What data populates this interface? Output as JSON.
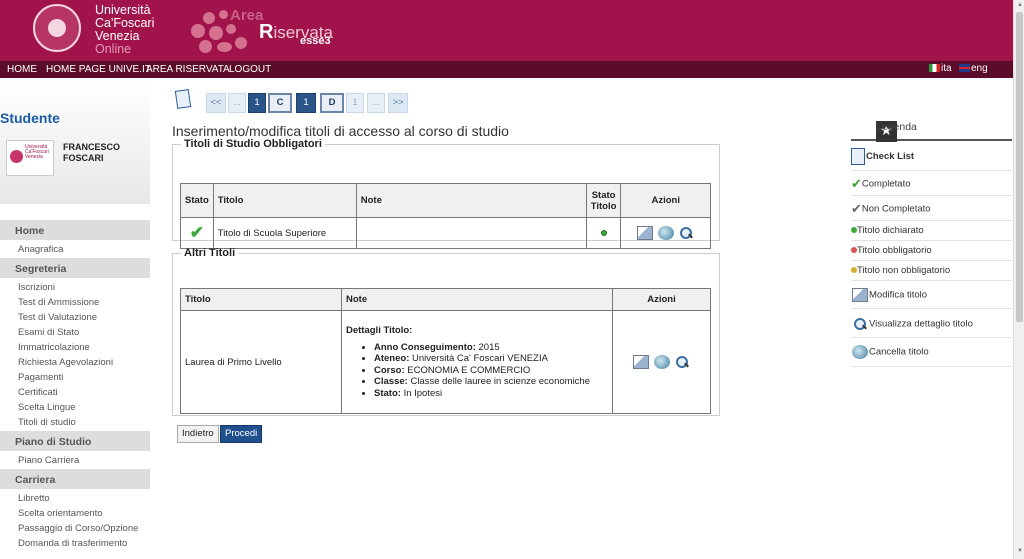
{
  "header": {
    "uni_line1": "Università",
    "uni_line2": "Ca'Foscari",
    "uni_line3": "Venezia",
    "uni_line4": "Online",
    "area_word": "Area",
    "riservata_word": "Riservata",
    "riservata_initial": "R",
    "riservata_rest": "iservata",
    "esse3": "esse3",
    "brand_color": "#a0144b"
  },
  "topnav": {
    "items": [
      "HOME",
      "HOME PAGE UNIVE.IT",
      "AREA RISERVATA",
      "LOGOUT"
    ],
    "lang_it": "ita",
    "lang_en": "eng"
  },
  "student": {
    "title": "Studente",
    "badge": "Università Ca'Foscari Venezia",
    "name_line1": "FRANCESCO",
    "name_line2": "FOSCARI"
  },
  "menu": {
    "home": "Home",
    "anagrafica": "Anagrafica",
    "segreteria": "Segreteria",
    "segreteria_items": [
      "Iscrizioni",
      "Test di Ammissione",
      "Test di Valutazione",
      "Esami di Stato",
      "Immatricolazione",
      "Richiesta Agevolazioni",
      "Pagamenti",
      "Certificati",
      "Scelta Lingue",
      "Titoli di studio"
    ],
    "piano": "Piano di Studio",
    "piano_items": [
      "Piano Carriera"
    ],
    "carriera": "Carriera",
    "carriera_items": [
      "Libretto",
      "Scelta orientamento",
      "Passaggio di Corso/Opzione",
      "Domanda di trasferimento"
    ]
  },
  "pager": {
    "first": "<<",
    "ellipsis": "...",
    "step1": "1",
    "labelC": "C",
    "step1b": "1",
    "labelD": "D",
    "next": "1",
    "ellipsis2": "...",
    "last": ">>"
  },
  "main": {
    "title": "Inserimento/modifica titoli di accesso al corso di studio",
    "obbligatori": {
      "legend": "Titoli di Studio Obbligatori",
      "headers": {
        "stato": "Stato",
        "titolo": "Titolo",
        "note": "Note",
        "stato_titolo_1": "Stato",
        "stato_titolo_2": "Titolo",
        "azioni": "Azioni"
      },
      "row": {
        "titolo": "Titolo di Scuola Superiore",
        "note": ""
      }
    },
    "altri": {
      "legend": "Altri Titoli",
      "headers": {
        "titolo": "Titolo",
        "note": "Note",
        "azioni": "Azioni"
      },
      "row": {
        "titolo": "Laurea di Primo Livello",
        "details_title": "Dettagli Titolo:",
        "details": [
          {
            "k": "Anno Conseguimento:",
            "v": "2015"
          },
          {
            "k": "Ateneo:",
            "v": "Università Ca' Foscari VENEZIA"
          },
          {
            "k": "Corso:",
            "v": "ECONOMIA E COMMERCIO"
          },
          {
            "k": "Classe:",
            "v": "Classe delle lauree in scienze economiche"
          },
          {
            "k": "Stato:",
            "v": "In Ipotesi"
          }
        ]
      }
    },
    "buttons": {
      "back": "Indietro",
      "proceed": "Procedi"
    }
  },
  "legend": {
    "title": "Legenda",
    "items": [
      "Check List",
      "Completato",
      "Non Completato",
      "Titolo dichiarato",
      "Titolo obbligatorio",
      "Titolo non obbligatorio",
      "Modifica titolo",
      "Visualizza dettaglio titolo",
      "Cancella titolo"
    ],
    "dot_colors": {
      "green": "#3aa83a",
      "red": "#d9534f",
      "yellow": "#d4b02a"
    }
  }
}
